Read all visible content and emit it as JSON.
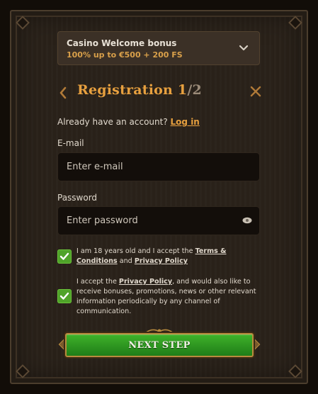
{
  "bonus": {
    "title": "Casino Welcome bonus",
    "subtitle": "100% up to €500 + 200 FS",
    "icon": "chevron-down-icon"
  },
  "registration": {
    "title": "Registration",
    "step": "1",
    "total": "/2"
  },
  "account": {
    "prompt": "Already have an account?",
    "login_label": "Log in"
  },
  "email": {
    "label": "E-mail",
    "placeholder": "Enter e-mail",
    "value": ""
  },
  "password": {
    "label": "Password",
    "placeholder": "Enter password",
    "value": "",
    "icon": "eye-icon"
  },
  "consents": [
    {
      "checked": true,
      "text_before": "I am 18 years old and I accept the",
      "link1": "Terms & Conditions",
      "text_mid": "and",
      "link2": "Privacy Policy"
    },
    {
      "checked": true,
      "text_before": "I accept the",
      "link1": "Privacy Policy",
      "text_after": ", and would also like to receive bonuses, promotions, news or other relevant information periodically by any channel of communication."
    }
  ],
  "next_button": {
    "label": "NEXT STEP"
  },
  "colors": {
    "accent": "#e7a03f",
    "panel": "#2a221a",
    "input_bg": "#130e0a",
    "check_green": "#4fa329",
    "button_green": "#2f9a22"
  }
}
